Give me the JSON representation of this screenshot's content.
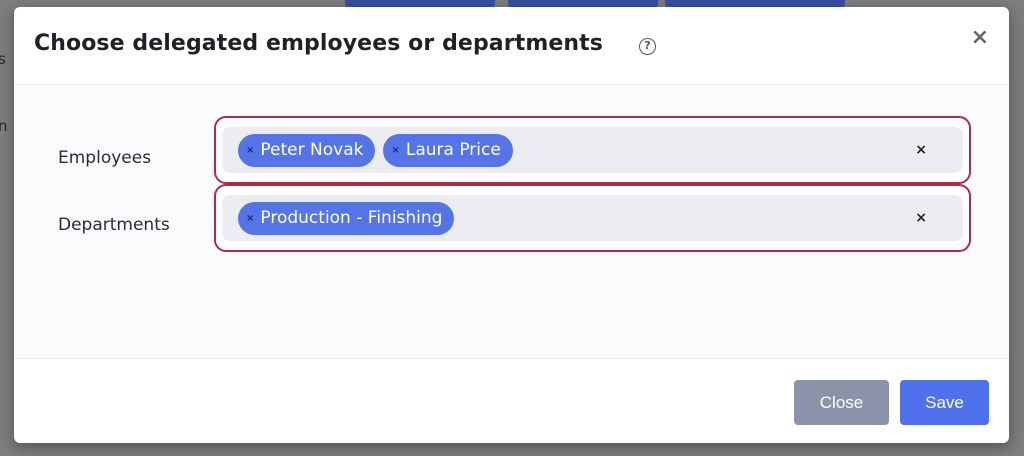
{
  "modal": {
    "title": "Choose delegated employees or departments",
    "help_icon": "?",
    "close_icon": "×"
  },
  "fields": {
    "employees": {
      "label": "Employees",
      "chips": [
        "Peter Novak",
        "Laura Price"
      ],
      "chip_remove": "×",
      "clear": "×"
    },
    "departments": {
      "label": "Departments",
      "chips": [
        "Production - Finishing"
      ],
      "chip_remove": "×",
      "clear": "×"
    }
  },
  "footer": {
    "close_label": "Close",
    "save_label": "Save"
  },
  "background": {
    "left_text_1": "s",
    "left_text_2": "n"
  },
  "colors": {
    "accent": "#5574e8",
    "highlight_border": "#b02a45",
    "save_button": "#4f71ec",
    "close_button": "#8a93a7"
  }
}
